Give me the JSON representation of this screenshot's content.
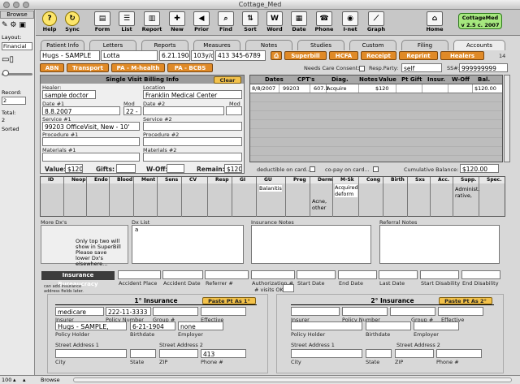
{
  "window": {
    "title": "Cottage_Med"
  },
  "sidebar": {
    "mode": "Browse",
    "layout_label": "Layout:",
    "layout_value": "Financial",
    "record_label": "Record:",
    "record_value": "2",
    "total_label": "Total:",
    "total_value": "2",
    "sort_label": "Sorted",
    "zoom": "100"
  },
  "toolbar": {
    "items": [
      "Help",
      "Sync",
      "Form",
      "List",
      "Report",
      "New",
      "Prior",
      "Find",
      "Sort",
      "Word",
      "Date",
      "Phone",
      "I-net",
      "Graph",
      "Home"
    ],
    "logo_line1": "CottageMed",
    "logo_line2": "v 2.5 c. 2007"
  },
  "tabs": [
    "Patient Info",
    "Letters",
    "Reports",
    "Measures",
    "Notes",
    "Studies",
    "Custom",
    "Filing",
    "Accounts"
  ],
  "patient": {
    "last": "Hugs - SAMPLE",
    "first": "Lotta",
    "dob": "6.21.1904",
    "age": "103y/o",
    "phone": "413 345-6789",
    "count": "14"
  },
  "actions": [
    "Superbill",
    "HCFA",
    "Receipt",
    "Reprint",
    "Healers"
  ],
  "subbtns": [
    "ABN",
    "Transport",
    "PA - M-health",
    "PA - BCBS"
  ],
  "consent": {
    "label": "Needs Care Consent:",
    "resp_label": "Resp.Party:",
    "resp_value": "self",
    "ss_label": "SS#:",
    "ss_value": "999999999"
  },
  "billing": {
    "title": "Single Visit Billing Info",
    "clear": "Clear",
    "healer_label": "Healer:",
    "healer": "sample doctor",
    "location_label": "Location",
    "location": "Franklin Medical Center",
    "date1_label": "Date #1",
    "date1": "8.8.2007",
    "mod_label": "Mod",
    "mod": "22 -",
    "date2_label": "Date #2",
    "mod2_label": "Mod",
    "svc1_label": "Service #1",
    "svc1": "99203  OfficeVisit, New - 10'",
    "svc2_label": "Service #2",
    "proc1_label": "Procedure #1",
    "proc2_label": "Procedure #2",
    "mat1_label": "Materials #1",
    "mat2_label": "Materials #2",
    "value_label": "Value:",
    "value": "$120",
    "gifts_label": "Gifts:",
    "woff_label": "W-Off:",
    "remain_label": "Remain:",
    "remain": "$120"
  },
  "ledger": {
    "headers": [
      "Dates",
      "CPT's",
      "Diag.",
      "Notes",
      "Value",
      "Pt Gift",
      "Insur.",
      "W-Off",
      "Bal."
    ],
    "rows": [
      [
        "8/8/2007",
        "99203",
        "607.1",
        "Acquire",
        "$120",
        "",
        "",
        "",
        "$120.00"
      ]
    ],
    "deduct_label": "deductible on card...",
    "copay_label": "co-pay on card...",
    "cum_label": "Cumulative Balance:",
    "cum_value": "$120.00"
  },
  "dx": {
    "cats": [
      "ID",
      "Neop",
      "Endo",
      "Blood",
      "Ment",
      "Sens",
      "CV",
      "Resp",
      "GI",
      "GU",
      "Preg",
      "Derm",
      "M-Sk",
      "Cong",
      "Birth",
      "Sxs",
      "Acc.",
      "Supp.",
      "Spec."
    ],
    "gu_entry": "Balanitis",
    "derm_entry": "Acne, other",
    "msk_entry": "Acquired deform",
    "supp_entry": "Administ. rative,"
  },
  "lists": {
    "more_dx": "More Dx's",
    "more_dx_note": "Only top two will show in SuperBill Please save lower Dx's elsewhere...",
    "dx_list": "Dx List",
    "dx_list_value": "a",
    "ins_notes": "Insurance Notes",
    "ref_notes": "Referral Notes"
  },
  "bureau": {
    "title": "Insurance Bureaucracy",
    "labels": [
      "Accident Place",
      "Accident Date",
      "Referrer #",
      "Authorization #",
      "Start Date",
      "End Date",
      "Last Date",
      "Start Disability",
      "End Disability"
    ],
    "visits_label": "# visits OK",
    "note": "can add insurance address fields later."
  },
  "ins1": {
    "title": "1° Insurance",
    "paste": "Paste Pt As 1°",
    "insurer": "medicare",
    "policy": "222-11-3333",
    "group": "none",
    "holder": "Hugs - SAMPLE,",
    "birth": "6-21-1904",
    "zip": "413"
  },
  "ins2": {
    "title": "2° Insurance",
    "paste": "Paste Pt As 2°"
  },
  "inslabels": {
    "insurer": "Insurer",
    "policy": "Policy Number",
    "group": "Group #",
    "effective": "Effective",
    "holder": "Policy Holder",
    "birth": "Birthdate",
    "employer": "Employer",
    "street1": "Street Address 1",
    "street2": "Street Address 2",
    "city": "City",
    "state": "State",
    "zip": "ZIP",
    "phone": "Phone #"
  },
  "status": {
    "mode": "Browse"
  }
}
